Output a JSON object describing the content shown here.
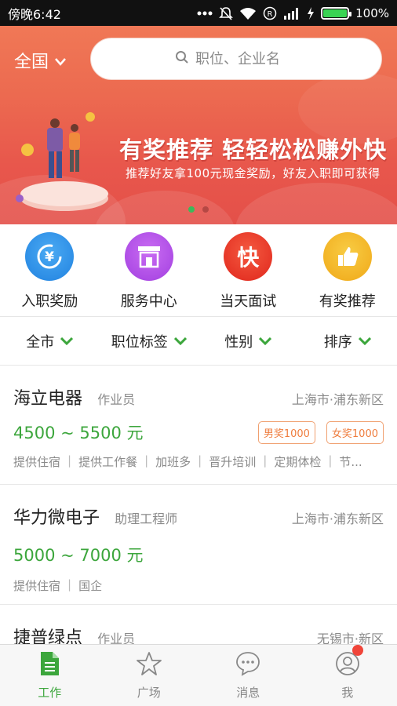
{
  "status_bar": {
    "time": "傍晚6:42",
    "battery_percent": "100%",
    "icons": [
      "dots-icon",
      "mute-icon",
      "wifi-icon",
      "r-icon",
      "signal-icon",
      "charging-icon",
      "battery-icon"
    ]
  },
  "header": {
    "region": "全国",
    "search_placeholder": "职位、企业名"
  },
  "banner": {
    "title": "有奖推荐 轻轻松松赚外快",
    "subtitle": "推荐好友拿100元现金奖励，好友入职即可获得",
    "page_count": 2,
    "active_page": 1
  },
  "quick_menu": [
    {
      "label": "入职奖励",
      "icon": "yen-refresh-icon",
      "color": "#2f93e8"
    },
    {
      "label": "服务中心",
      "icon": "storefront-icon",
      "color": "#b04ee8"
    },
    {
      "label": "当天面试",
      "icon": "kuai-icon",
      "icon_text": "快",
      "color": "#ef3a2a"
    },
    {
      "label": "有奖推荐",
      "icon": "thumbs-up-icon",
      "color": "#f4b520"
    }
  ],
  "filters": [
    {
      "label": "全市"
    },
    {
      "label": "职位标签"
    },
    {
      "label": "性别"
    },
    {
      "label": "排序"
    }
  ],
  "jobs": [
    {
      "company": "海立电器",
      "role": "作业员",
      "location": "上海市·浦东新区",
      "salary": "4500 ~ 5500 元",
      "badges": [
        "男奖1000",
        "女奖1000"
      ],
      "tags": [
        "提供住宿",
        "提供工作餐",
        "加班多",
        "晋升培训",
        "定期体检",
        "节..."
      ]
    },
    {
      "company": "华力微电子",
      "role": "助理工程师",
      "location": "上海市·浦东新区",
      "salary": "5000 ~ 7000 元",
      "badges": [],
      "tags": [
        "提供住宿",
        "国企"
      ]
    },
    {
      "company": "捷普绿点",
      "role": "作业员",
      "location": "无锡市·新区"
    }
  ],
  "tab_bar": [
    {
      "label": "工作",
      "icon": "document-icon",
      "active": true
    },
    {
      "label": "广场",
      "icon": "star-icon",
      "active": false
    },
    {
      "label": "消息",
      "icon": "chat-bubble-icon",
      "active": false
    },
    {
      "label": "我",
      "icon": "user-icon",
      "active": false,
      "notification_dot": true
    }
  ],
  "colors": {
    "accent_green": "#3ca63c",
    "banner_red": "#e8574c",
    "badge_orange": "#ef7d3e"
  }
}
